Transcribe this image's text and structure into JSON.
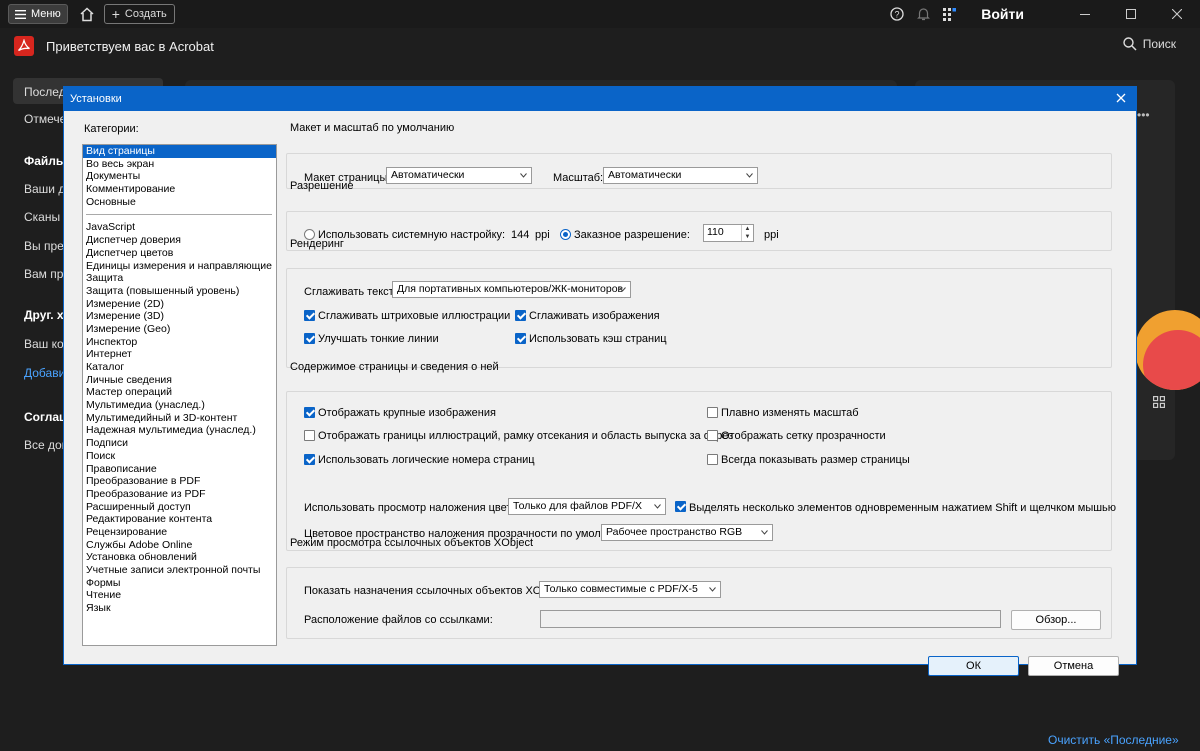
{
  "titlebar": {
    "menu_label": "Меню",
    "create_label": "Создать",
    "login_label": "Войти"
  },
  "appbar": {
    "title": "Приветствуем вас в Acrobat",
    "search_label": "Поиск"
  },
  "sidebar": {
    "items": [
      "Последн",
      "Отмечен",
      "Файлы",
      "Ваши д",
      "Сканы",
      "Вы пред",
      "Вам пре",
      "Друг. хр",
      "Ваш ком",
      "Добави",
      "Соглаш",
      "Все док"
    ]
  },
  "footer": {
    "clear_recent": "Очистить «Последние»"
  },
  "dialog": {
    "title": "Установки",
    "categories_label": "Категории:",
    "categories_top": [
      "Вид страницы",
      "Во весь экран",
      "Документы",
      "Комментирование",
      "Основные"
    ],
    "categories_rest": [
      "JavaScript",
      "Диспетчер доверия",
      "Диспетчер цветов",
      "Единицы измерения и направляющие",
      "Защита",
      "Защита (повышенный уровень)",
      "Измерение (2D)",
      "Измерение (3D)",
      "Измерение (Geo)",
      "Инспектор",
      "Интернет",
      "Каталог",
      "Личные сведения",
      "Мастер операций",
      "Мультимедиа (унаслед.)",
      "Мультимедийный и 3D-контент",
      "Надежная мультимедиа (унаслед.)",
      "Подписи",
      "Поиск",
      "Правописание",
      "Преобразование в PDF",
      "Преобразование из PDF",
      "Расширенный доступ",
      "Редактирование контента",
      "Рецензирование",
      "Службы Adobe Online",
      "Установка обновлений",
      "Учетные записи электронной почты",
      "Формы",
      "Чтение",
      "Язык"
    ],
    "layout": {
      "section": "Макет и масштаб по умолчанию",
      "page_layout_label": "Макет страницы:",
      "page_layout_value": "Автоматически",
      "zoom_label": "Масштаб:",
      "zoom_value": "Автоматически"
    },
    "resolution": {
      "section": "Разрешение",
      "system_label": "Использовать системную настройку:",
      "system_value": "144",
      "ppi": "ppi",
      "custom_label": "Заказное разрешение:",
      "custom_value": "110"
    },
    "rendering": {
      "section": "Рендеринг",
      "smooth_text_label": "Сглаживать текст:",
      "smooth_text_value": "Для портативных компьютеров/ЖК-мониторов",
      "smooth_line_art": "Сглаживать штриховые иллюстрации",
      "smooth_images": "Сглаживать изображения",
      "enhance_thin_lines": "Улучшать тонкие линии",
      "use_page_cache": "Использовать кэш страниц"
    },
    "page_content": {
      "section": "Содержимое страницы и сведения о ней",
      "show_large_images": "Отображать крупные изображения",
      "smooth_zoom": "Плавно изменять масштаб",
      "show_art_boxes": "Отображать границы иллюстраций, рамку отсекания и область выпуска за обрез",
      "show_transparency_grid": "Отображать сетку прозрачности",
      "logical_page_numbers": "Использовать логические номера страниц",
      "always_show_page_size": "Всегда показывать размер страницы",
      "overprint_label": "Использовать просмотр наложения цветов:",
      "overprint_value": "Только для файлов PDF/X",
      "shift_select": "Выделять несколько элементов одновременным нажатием Shift и щелчком мышью",
      "blend_space_label": "Цветовое пространство наложения прозрачности по умолчанию:",
      "blend_space_value": "Рабочее пространство RGB"
    },
    "xobject": {
      "section": "Режим просмотра ссылочных объектов XObject",
      "show_targets_label": "Показать назначения ссылочных объектов XObject:",
      "show_targets_value": "Только совместимые с PDF/X-5",
      "location_label": "Расположение файлов со ссылками:",
      "location_value": "",
      "browse": "Обзор..."
    },
    "ok": "ОК",
    "cancel": "Отмена"
  }
}
